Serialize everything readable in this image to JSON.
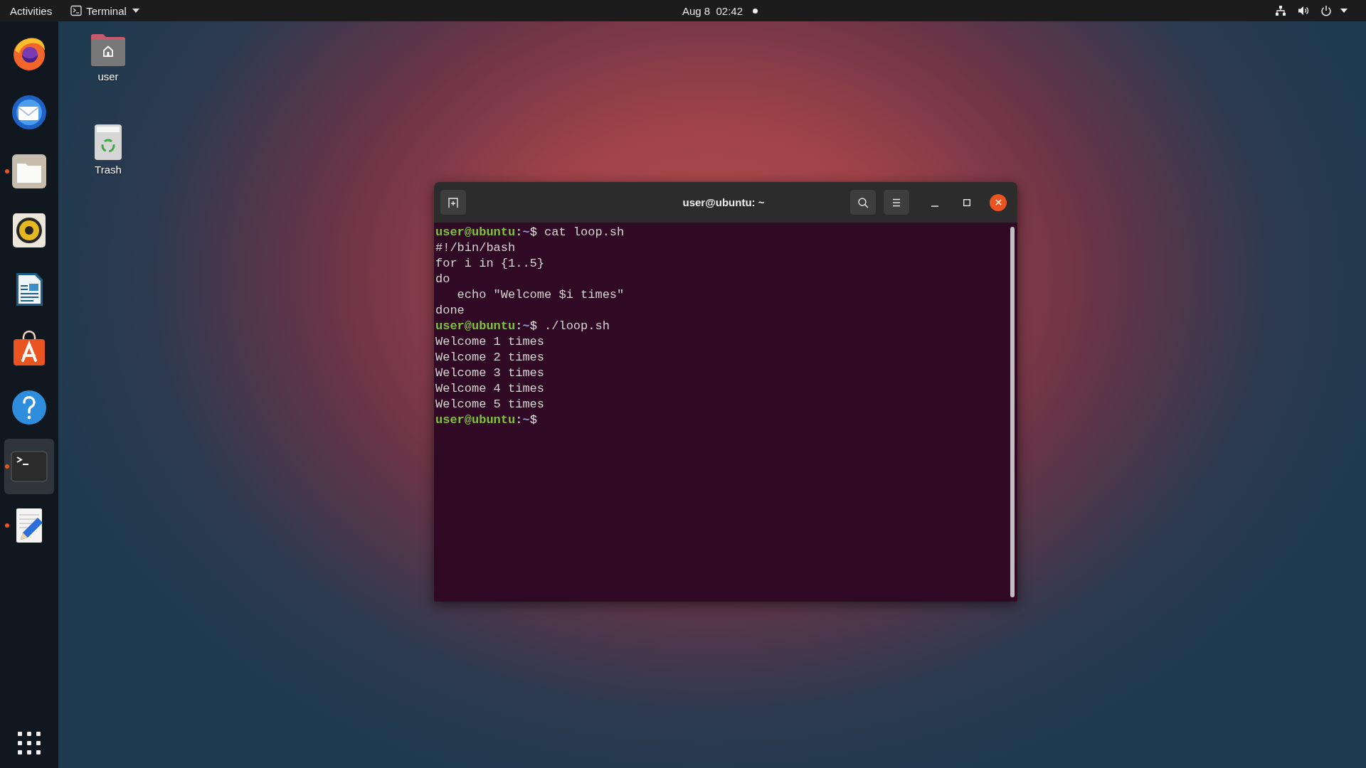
{
  "top_bar": {
    "activities": "Activities",
    "app_menu": "Terminal",
    "clock": "Aug 8  02:42",
    "notification_dot": true
  },
  "dock": {
    "apps": [
      {
        "kind": "browser",
        "running": false,
        "selected": false
      },
      {
        "kind": "mail",
        "running": false,
        "selected": false
      },
      {
        "kind": "files",
        "running": true,
        "selected": false
      },
      {
        "kind": "music",
        "running": false,
        "selected": false
      },
      {
        "kind": "writer",
        "running": false,
        "selected": false
      },
      {
        "kind": "store",
        "running": false,
        "selected": false
      },
      {
        "kind": "help",
        "running": false,
        "selected": false
      },
      {
        "kind": "terminal",
        "running": true,
        "selected": true
      },
      {
        "kind": "editor",
        "running": true,
        "selected": false
      }
    ]
  },
  "desktop_icons": [
    {
      "kind": "home",
      "label": "user"
    },
    {
      "kind": "trash",
      "label": "Trash"
    }
  ],
  "terminal": {
    "title": "user@ubuntu: ~",
    "lines": [
      {
        "kind": "prompt",
        "user_host": "user@ubuntu",
        "separator": ":",
        "path": "~",
        "sign": "$",
        "command": "cat loop.sh"
      },
      {
        "kind": "output",
        "text": "#!/bin/bash"
      },
      {
        "kind": "output",
        "text": "for i in {1..5}"
      },
      {
        "kind": "output",
        "text": "do"
      },
      {
        "kind": "output",
        "text": "   echo \"Welcome $i times\""
      },
      {
        "kind": "output",
        "text": "done"
      },
      {
        "kind": "prompt",
        "user_host": "user@ubuntu",
        "separator": ":",
        "path": "~",
        "sign": "$",
        "command": "./loop.sh"
      },
      {
        "kind": "output",
        "text": "Welcome 1 times"
      },
      {
        "kind": "output",
        "text": "Welcome 2 times"
      },
      {
        "kind": "output",
        "text": "Welcome 3 times"
      },
      {
        "kind": "output",
        "text": "Welcome 4 times"
      },
      {
        "kind": "output",
        "text": "Welcome 5 times"
      },
      {
        "kind": "prompt",
        "user_host": "user@ubuntu",
        "separator": ":",
        "path": "~",
        "sign": "$"
      }
    ]
  }
}
